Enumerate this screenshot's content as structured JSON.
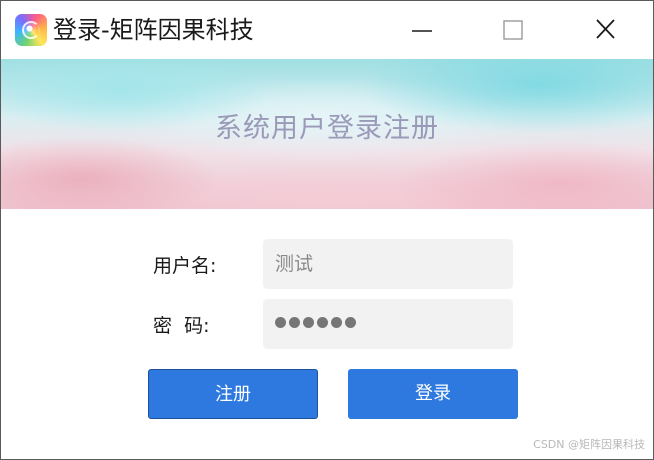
{
  "window": {
    "title": "登录-矩阵因果科技",
    "icon": "app-logo-icon"
  },
  "banner": {
    "title": "系统用户登录注册"
  },
  "form": {
    "username_label": "用户名:",
    "username_value": "测试",
    "password_label": "密  码:",
    "password_mask_count": 6
  },
  "buttons": {
    "register_label": "注册",
    "login_label": "登录"
  },
  "watermark": {
    "text": "CSDN @矩阵因果科技"
  },
  "colors": {
    "button_blue": "#2d79e0",
    "banner_title": "#9a9ab8",
    "field_bg": "#f2f2f2"
  }
}
